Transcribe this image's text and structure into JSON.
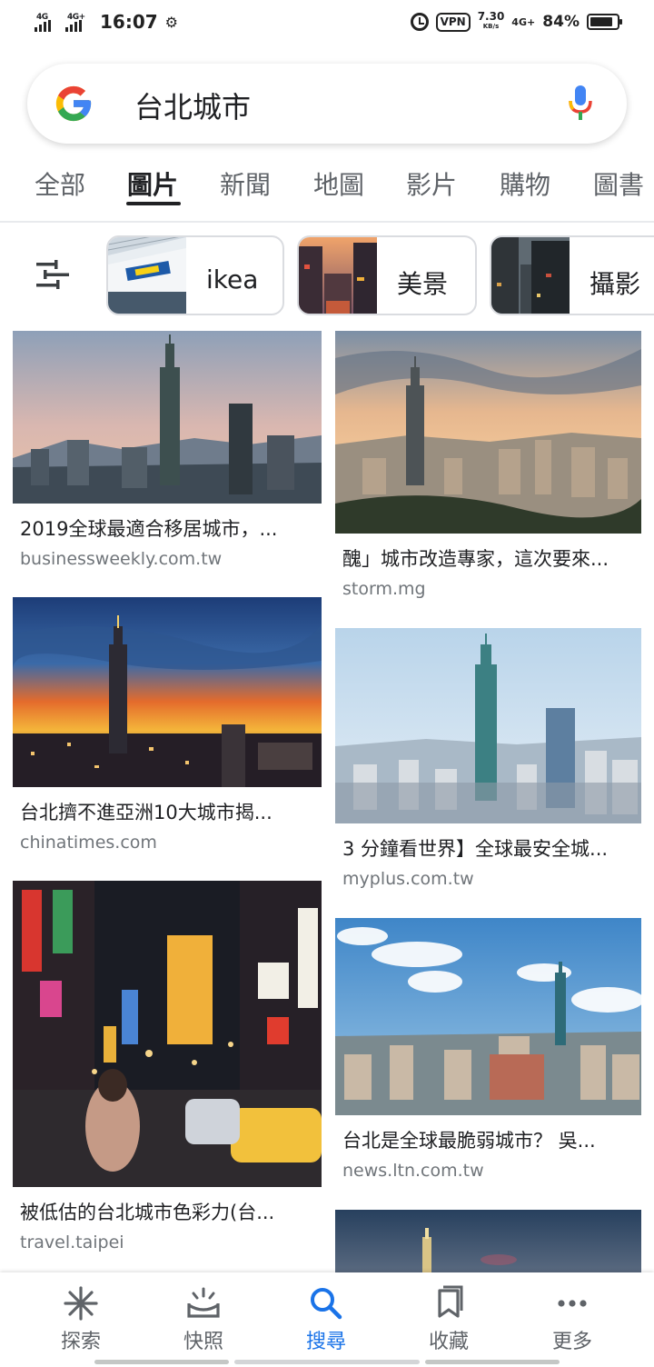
{
  "status_bar": {
    "signal1": "4G",
    "signal2": "4G+",
    "time": "16:07",
    "vpn": "VPN",
    "speed_value": "7.30",
    "speed_unit": "KB/s",
    "network": "4G+",
    "battery_pct": "84%",
    "battery_level": 0.84
  },
  "search": {
    "query": "台北城市"
  },
  "tabs": [
    "全部",
    "圖片",
    "新聞",
    "地圖",
    "影片",
    "購物",
    "圖書"
  ],
  "active_tab": "圖片",
  "chips": [
    {
      "label": "ikea"
    },
    {
      "label": "美景"
    },
    {
      "label": "攝影"
    }
  ],
  "results_left": [
    {
      "title": "2019全球最適合移居城市，...",
      "source": "businessweekly.com.tw"
    },
    {
      "title": "台北擠不進亞洲10大城市揭...",
      "source": "chinatimes.com"
    },
    {
      "title": "被低估的台北城市色彩力(台...",
      "source": "travel.taipei"
    }
  ],
  "results_right": [
    {
      "title": "醜」城市改造專家，這次要來...",
      "source": "storm.mg"
    },
    {
      "title": "3 分鐘看世界】全球最安全城...",
      "source": "myplus.com.tw"
    },
    {
      "title": "台北是全球最脆弱城市？ 吳...",
      "source": "news.ltn.com.tw"
    }
  ],
  "bottom_nav": [
    {
      "label": "探索",
      "icon": "asterisk-icon"
    },
    {
      "label": "快照",
      "icon": "snapshot-icon"
    },
    {
      "label": "搜尋",
      "icon": "search-icon"
    },
    {
      "label": "收藏",
      "icon": "collections-icon"
    },
    {
      "label": "更多",
      "icon": "more-dots-icon"
    }
  ],
  "colors": {
    "accent": "#1a73e8",
    "google_blue": "#4285F4",
    "google_red": "#EA4335",
    "google_yellow": "#FBBC05",
    "google_green": "#34A853"
  }
}
